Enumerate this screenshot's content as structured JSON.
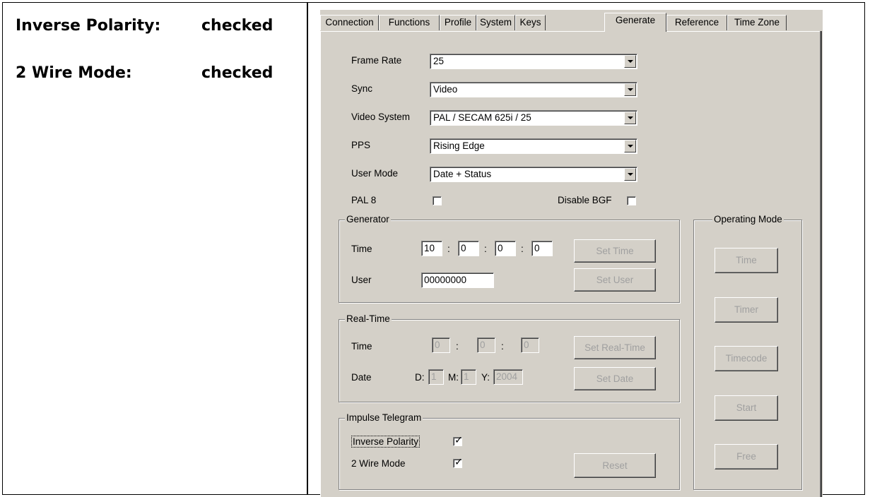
{
  "doc": {
    "row1_label": "Inverse Polarity:",
    "row1_value": "checked",
    "row2_label": "2 Wire Mode:",
    "row2_value": "checked"
  },
  "tabs": [
    "Connection",
    "Functions",
    "Profile",
    "System",
    "Keys",
    "Generate",
    "Reference",
    "Time Zone"
  ],
  "active_tab": "Generate",
  "settings": {
    "frame_rate_label": "Frame Rate",
    "frame_rate": "25",
    "sync_label": "Sync",
    "sync": "Video",
    "video_system_label": "Video System",
    "video_system": "PAL / SECAM 625i / 25",
    "pps_label": "PPS",
    "pps": "Rising Edge",
    "user_mode_label": "User Mode",
    "user_mode": "Date + Status",
    "pal8_label": "PAL 8",
    "pal8_checked": false,
    "disable_bgf_label": "Disable BGF",
    "disable_bgf_checked": false
  },
  "generator": {
    "title": "Generator",
    "time_label": "Time",
    "hh": "10",
    "mm": "0",
    "ss": "0",
    "ff": "0",
    "sep": ":",
    "set_time": "Set Time",
    "user_label": "User",
    "user_value": "00000000",
    "set_user": "Set User"
  },
  "realtime": {
    "title": "Real-Time",
    "time_label": "Time",
    "hh": "0",
    "mm": "0",
    "ss": "0",
    "sep": ":",
    "set_realtime": "Set Real-Time",
    "date_label": "Date",
    "d_label": "D:",
    "d": "1",
    "m_label": "M:",
    "m": "1",
    "y_label": "Y:",
    "y": "2004",
    "set_date": "Set Date"
  },
  "impulse": {
    "title": "Impulse Telegram",
    "inverse_polarity_label": "Inverse Polarity",
    "inverse_polarity_checked": true,
    "two_wire_label": "2 Wire Mode",
    "two_wire_checked": true,
    "reset": "Reset"
  },
  "operating_mode": {
    "title": "Operating Mode",
    "buttons": [
      "Time",
      "Timer",
      "Timecode",
      "Start",
      "Free"
    ]
  },
  "check_glyph": "✓"
}
